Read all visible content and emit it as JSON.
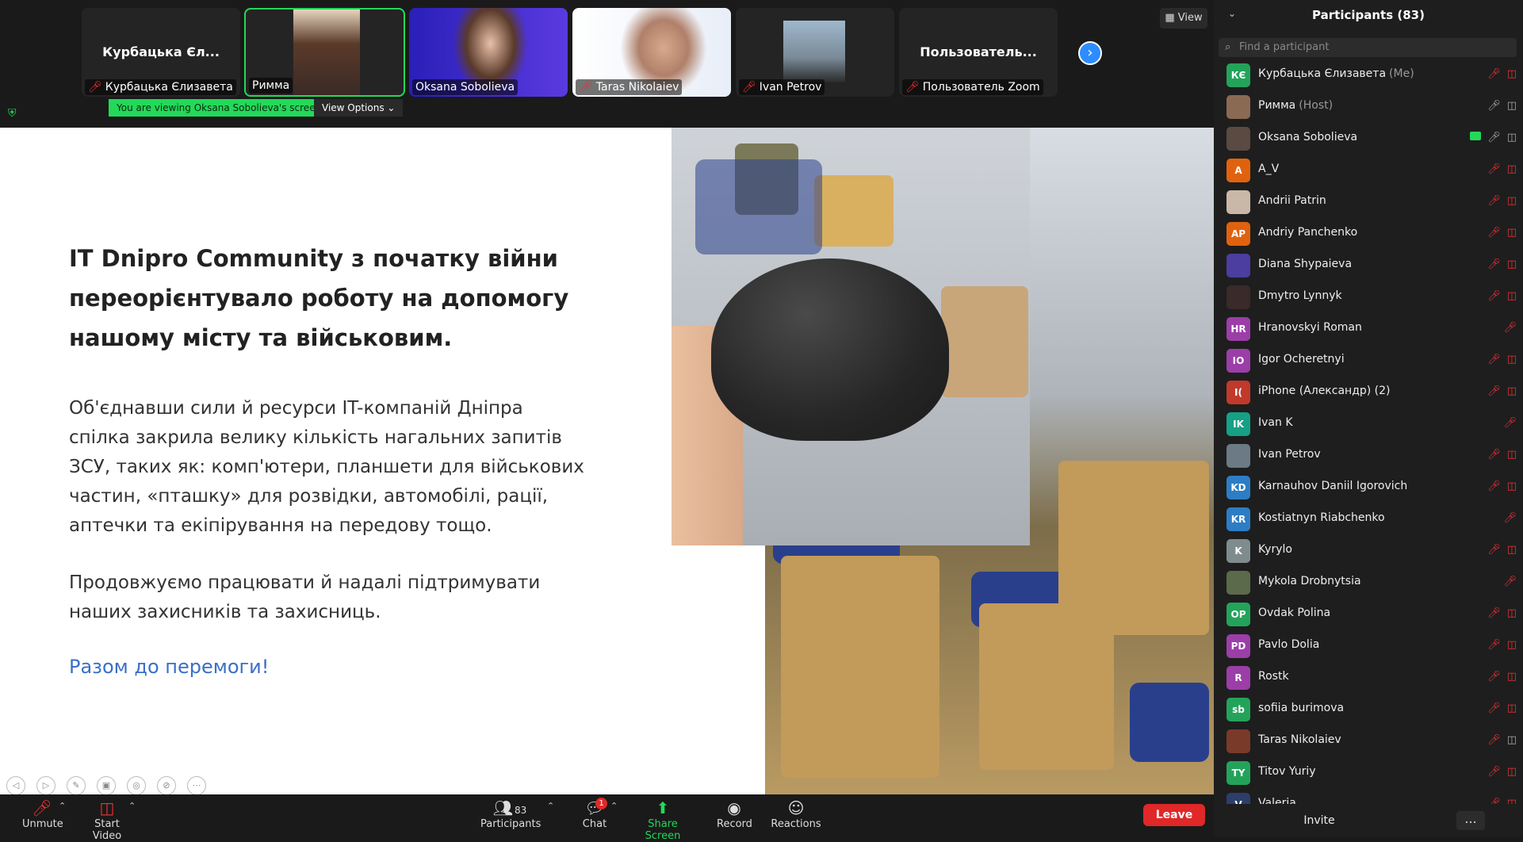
{
  "tiles": [
    {
      "big": "Курбацька Єл...",
      "label": "Курбацька Єлизавета",
      "muted": true
    },
    {
      "big": "",
      "label": "Римма",
      "muted": false
    },
    {
      "big": "",
      "label": "Oksana Sobolieva",
      "muted": false
    },
    {
      "big": "",
      "label": "Taras Nikolaiev",
      "muted": true
    },
    {
      "big": "",
      "label": "Ivan Petrov",
      "muted": true
    },
    {
      "big": "Пользователь...",
      "label": "Пользователь Zoom",
      "muted": true
    }
  ],
  "view_label": "View",
  "viewing_text": "You are viewing Oksana Sobolieva's screen",
  "view_options": "View Options",
  "slide": {
    "title": "IT Dnipro Community з початку війни переорієнтувало роботу на допомогу нашому місту та військовим.",
    "para1": "Об'єднавши сили й ресурси IT-компаній Дніпра спілка закрила велику кількість нагальних запитів ЗСУ, таких як: комп'ютери, планшети для військових частин, «пташку» для розвідки, автомобілі, рації, аптечки та екіпірування на передову тощо.",
    "para2": "Продовжуємо працювати й надалі підтримувати наших захисників та захисниць.",
    "link": "Разом до перемоги!"
  },
  "toolbar": {
    "unmute": "Unmute",
    "start_video": "Start Video",
    "participants": "Participants",
    "participants_count": "83",
    "chat": "Chat",
    "chat_badge": "1",
    "share": "Share Screen",
    "record": "Record",
    "reactions": "Reactions",
    "leave": "Leave"
  },
  "panel": {
    "title": "Participants (83)",
    "search_placeholder": "Find a participant",
    "invite": "Invite",
    "more": "...",
    "participants": [
      {
        "initials": "КЄ",
        "name": "Курбацька Єлизавета",
        "role": "(Me)",
        "color": "#23a35a",
        "state": "muted"
      },
      {
        "initials": "",
        "name": "Римма",
        "role": "(Host)",
        "color": "#8a6a52",
        "state": "on"
      },
      {
        "initials": "",
        "name": "Oksana Sobolieva",
        "role": "",
        "color": "#5a4a42",
        "state": "share"
      },
      {
        "initials": "A",
        "name": "A_V",
        "role": "",
        "color": "#e0620f",
        "state": "muted"
      },
      {
        "initials": "",
        "name": "Andrii Patrin",
        "role": "",
        "color": "#c9b8a8",
        "state": "muted"
      },
      {
        "initials": "AP",
        "name": "Andriy Panchenko",
        "role": "",
        "color": "#e0620f",
        "state": "muted"
      },
      {
        "initials": "",
        "name": "Diana Shypaieva",
        "role": "",
        "color": "#4b3ea0",
        "state": "muted"
      },
      {
        "initials": "",
        "name": "Dmytro Lynnyk",
        "role": "",
        "color": "#3a2a2a",
        "state": "muted"
      },
      {
        "initials": "HR",
        "name": "Hranovskyi Roman",
        "role": "",
        "color": "#9b3ea8",
        "state": "mic"
      },
      {
        "initials": "IO",
        "name": "Igor Ocheretnyi",
        "role": "",
        "color": "#9b3ea8",
        "state": "muted"
      },
      {
        "initials": "I(",
        "name": "iPhone (Александр) (2)",
        "role": "",
        "color": "#c0392b",
        "state": "muted"
      },
      {
        "initials": "IK",
        "name": "Ivan K",
        "role": "",
        "color": "#16a085",
        "state": "mic"
      },
      {
        "initials": "",
        "name": "Ivan Petrov",
        "role": "",
        "color": "#6b7a84",
        "state": "muted"
      },
      {
        "initials": "KD",
        "name": "Karnauhov Daniil Igorovich",
        "role": "",
        "color": "#2d7dc4",
        "state": "muted"
      },
      {
        "initials": "KR",
        "name": "Kostiatnyn Riabchenko",
        "role": "",
        "color": "#2d7dc4",
        "state": "mic"
      },
      {
        "initials": "K",
        "name": "Kyrylo",
        "role": "",
        "color": "#7f8c8d",
        "state": "muted"
      },
      {
        "initials": "",
        "name": "Mykola Drobnytsia",
        "role": "",
        "color": "#5a6a4a",
        "state": "mic"
      },
      {
        "initials": "OP",
        "name": "Ovdak Polina",
        "role": "",
        "color": "#23a35a",
        "state": "muted"
      },
      {
        "initials": "PD",
        "name": "Pavlo Dolia",
        "role": "",
        "color": "#9b3ea8",
        "state": "muted"
      },
      {
        "initials": "R",
        "name": "Rostk",
        "role": "",
        "color": "#9b3ea8",
        "state": "muted"
      },
      {
        "initials": "sb",
        "name": "sofiia burimova",
        "role": "",
        "color": "#23a35a",
        "state": "muted"
      },
      {
        "initials": "",
        "name": "Taras Nikolaiev",
        "role": "",
        "color": "#7a3a2a",
        "state": "mutedvid"
      },
      {
        "initials": "TY",
        "name": "Titov Yuriy",
        "role": "",
        "color": "#23a35a",
        "state": "muted"
      },
      {
        "initials": "V",
        "name": "Valeria",
        "role": "",
        "color": "#2c3e6a",
        "state": "muted"
      }
    ]
  }
}
